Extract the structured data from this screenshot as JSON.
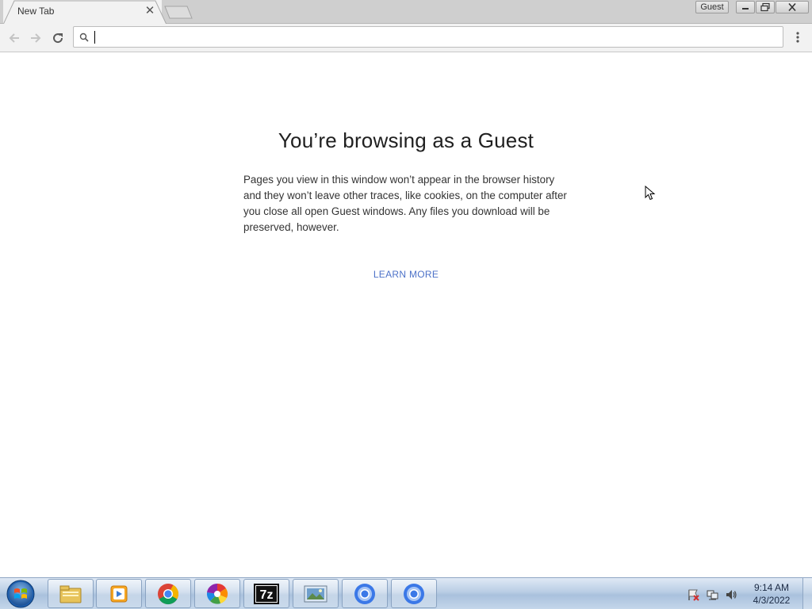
{
  "window": {
    "profile_badge": "Guest"
  },
  "tabs": [
    {
      "title": "New Tab"
    }
  ],
  "toolbar": {
    "omnibox_value": ""
  },
  "guest_page": {
    "heading": "You’re browsing as a Guest",
    "body": "Pages you view in this window won’t appear in the browser history and they won’t leave other traces, like cookies, on the computer after you close all open Guest windows. Any files you download will be preserved, however.",
    "learn_more": "LEARN MORE",
    "link_color": "#4d72c8"
  },
  "taskbar": {
    "pinned": [
      "file-explorer-icon",
      "media-player-icon",
      "chrome-icon",
      "photos-icon",
      "7zip-icon",
      "image-viewer-icon",
      "chromium-icon",
      "chromium-icon"
    ],
    "clock_time": "9:14 AM",
    "clock_date": "4/3/2022"
  }
}
